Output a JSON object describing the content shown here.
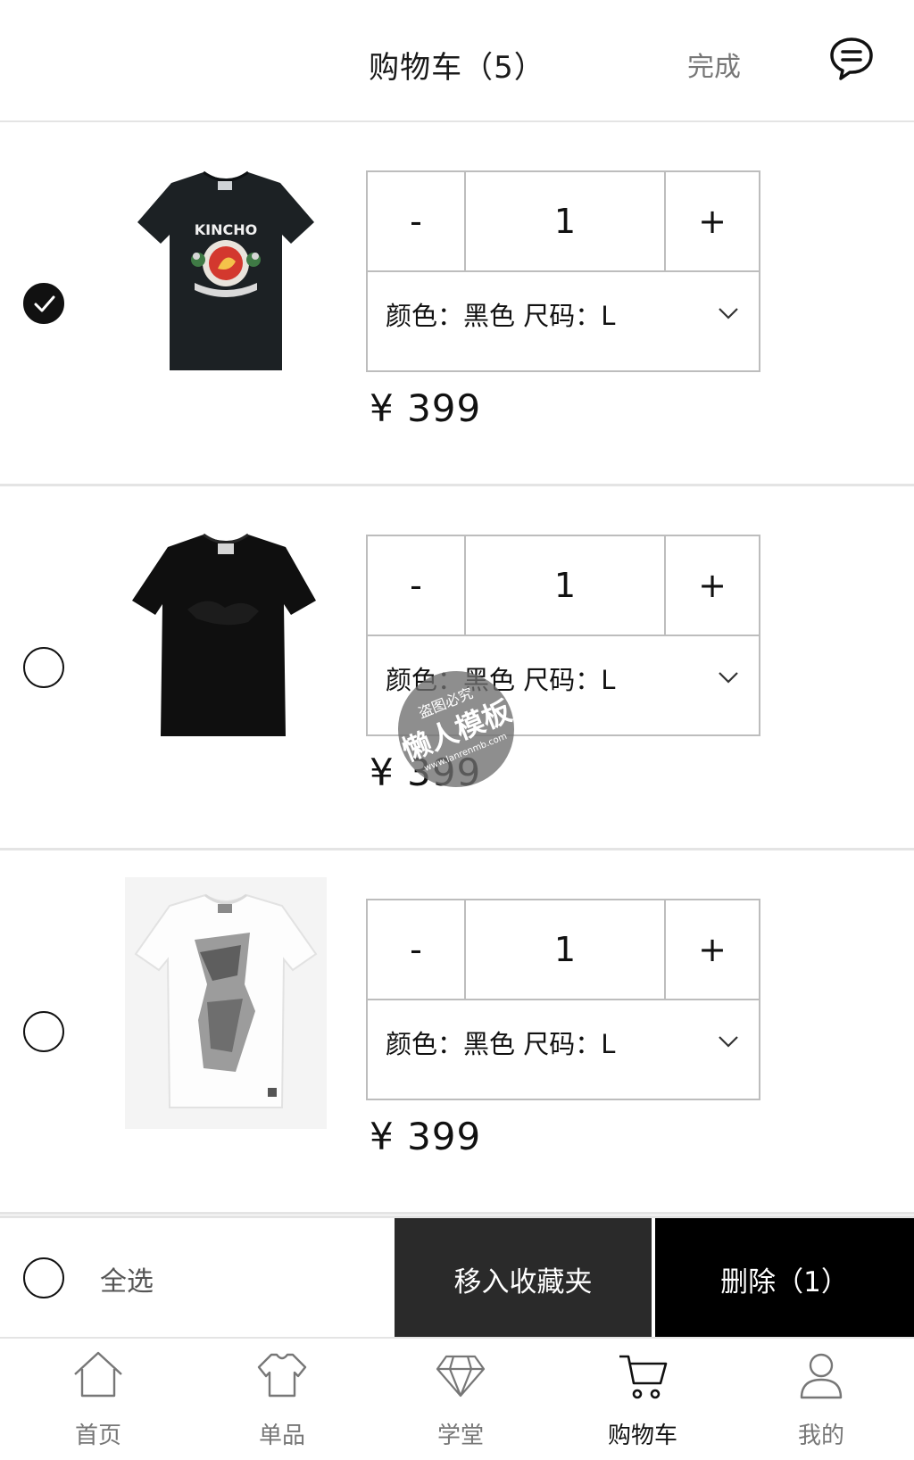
{
  "header": {
    "title": "购物车（5）",
    "done_label": "完成",
    "message_icon": "chat-bubble-icon"
  },
  "items": [
    {
      "selected": true,
      "quantity": "1",
      "minus_label": "-",
      "plus_label": "+",
      "variant_label": "颜色：黑色   尺码：L",
      "price": "¥  399",
      "image": "black t-shirt with KINCHO rooster print"
    },
    {
      "selected": false,
      "quantity": "1",
      "minus_label": "-",
      "plus_label": "+",
      "variant_label": "颜色：黑色   尺码：L",
      "price": "¥  399",
      "image": "plain black t-shirt"
    },
    {
      "selected": false,
      "quantity": "1",
      "minus_label": "-",
      "plus_label": "+",
      "variant_label": "颜色：黑色   尺码：L",
      "price": "¥  399",
      "image": "white t-shirt with grey graphic print"
    }
  ],
  "footer": {
    "select_all_label": "全选",
    "favorite_button": "移入收藏夹",
    "delete_button": "删除（1）"
  },
  "tabs": [
    {
      "label": "首页",
      "icon": "home-icon",
      "active": false
    },
    {
      "label": "单品",
      "icon": "tshirt-icon",
      "active": false
    },
    {
      "label": "学堂",
      "icon": "diamond-icon",
      "active": false
    },
    {
      "label": "购物车",
      "icon": "cart-icon",
      "active": true
    },
    {
      "label": "我的",
      "icon": "user-icon",
      "active": false
    }
  ],
  "watermark": {
    "line1": "盗图必究",
    "line2": "懒人模板",
    "line3": "www.lanrenmb.com"
  }
}
